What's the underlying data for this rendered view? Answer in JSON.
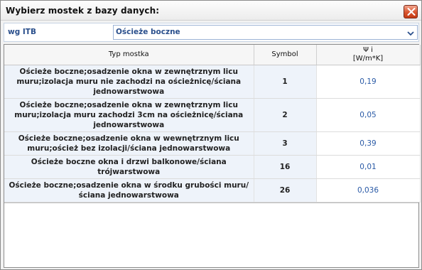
{
  "window": {
    "title": "Wybierz mostek z bazy danych:"
  },
  "filter": {
    "label": "wg ITB",
    "selected": "Ościeże boczne"
  },
  "table": {
    "headers": {
      "type": "Typ mostka",
      "symbol": "Symbol",
      "psi_line1": "Ψ i",
      "psi_line2": "[W/m*K]"
    },
    "rows": [
      {
        "name": "Ościeże boczne;osadzenie okna w zewnętrznym licu muru;izolacja muru nie zachodzi na ościeżnicę/ściana jednowarstwowa",
        "symbol": "1",
        "psi": "0,19"
      },
      {
        "name": "Ościeże boczne;osadzenie okna w zewnętrznym licu muru;izolacja muru zachodzi 3cm na ościeżnicę/ściana jednowarstwowa",
        "symbol": "2",
        "psi": "0,05"
      },
      {
        "name": "Ościeże boczne;osadzenie okna w wewnętrznym licu muru;oścież bez izolacji/ściana jednowarstwowa",
        "symbol": "3",
        "psi": "0,39"
      },
      {
        "name": "Ościeże boczne okna i drzwi balkonowe/ściana trójwarstwowa",
        "symbol": "16",
        "psi": "0,01"
      },
      {
        "name": "Ościeże boczne;osadzenie okna w środku grubości muru/ściana jednowarstwowa",
        "symbol": "26",
        "psi": "0,036"
      }
    ]
  },
  "icons": {
    "close": "close-icon",
    "dropdown": "chevron-down-icon"
  }
}
